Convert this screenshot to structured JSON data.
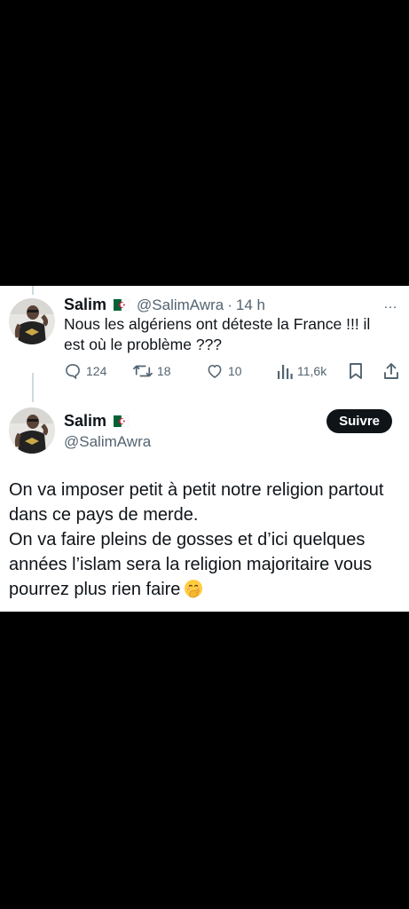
{
  "reply_tweet": {
    "name": "Salim",
    "flag_icon": "algeria-flag-icon",
    "handle": "@SalimAwra",
    "separator": "·",
    "time": "14 h",
    "more_icon": "…",
    "text": "Nous les algériens ont déteste la France !!!  il est où le problème ???",
    "stats": {
      "replies": "124",
      "reposts": "18",
      "likes": "10",
      "views": "11,6k"
    }
  },
  "main_tweet": {
    "name": "Salim",
    "flag_icon": "algeria-flag-icon",
    "handle": "@SalimAwra",
    "follow_label": "Suivre",
    "paragraph_1": "On va imposer petit à petit notre religion partout dans ce pays de merde.",
    "paragraph_2": "On va faire pleins de gosses et d’ici quelques années l’islam sera la religion majoritaire vous pourrez plus rien faire",
    "emoji": "hand-over-mouth-emoji"
  },
  "colors": {
    "text": "#0f1419",
    "secondary": "#536471",
    "button_bg": "#0f1419",
    "button_text": "#ffffff",
    "background_outer": "#000000",
    "background_card": "#ffffff"
  }
}
